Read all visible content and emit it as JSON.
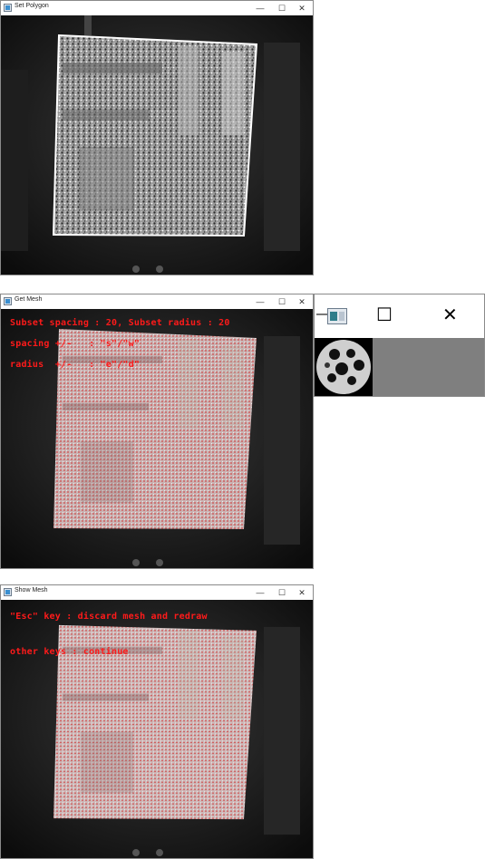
{
  "windows": [
    {
      "title": "Set Polygon",
      "buttons": {
        "minimize": "—",
        "maximize": "☐",
        "close": "✕"
      },
      "overlay": []
    },
    {
      "title": "Get Mesh",
      "buttons": {
        "minimize": "—",
        "maximize": "☐",
        "close": "✕"
      },
      "overlay": [
        "Subset spacing : 20, Subset radius : 20",
        "spacing +/-   : \"s\"/\"w\"",
        "radius  +/-   : \"e\"/\"d\""
      ]
    },
    {
      "title": "Show Mesh",
      "buttons": {
        "minimize": "—",
        "maximize": "☐",
        "close": "✕"
      },
      "overlay": [
        "\"Esc\" key : discard mesh and redraw",
        "other keys : continue"
      ]
    }
  ],
  "subset_window": {
    "buttons": {
      "minimize": "—",
      "maximize": "☐",
      "close": "✕"
    }
  },
  "colors": {
    "overlay_text": "#ff1a1a",
    "polygon_outline": "#ffffff",
    "mesh_points": "#e05050",
    "image_background": "#111111"
  }
}
